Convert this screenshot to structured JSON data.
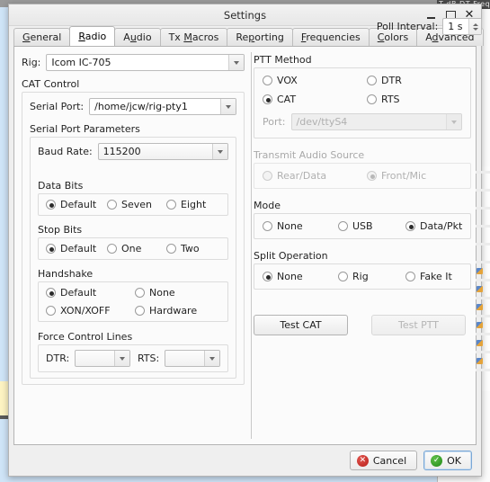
{
  "background": {
    "top_right_window_title": "T  dB   DT  Freq"
  },
  "window": {
    "title": "Settings",
    "controls": {
      "minimize": "minimize-icon",
      "maximize": "maximize-icon",
      "close": "close-icon"
    }
  },
  "tabs": [
    {
      "label": "General",
      "mnemonic": "G",
      "active": false
    },
    {
      "label": "Radio",
      "mnemonic": "R",
      "active": true
    },
    {
      "label": "Audio",
      "mnemonic": "u",
      "active": false
    },
    {
      "label": "Tx Macros",
      "mnemonic": "M",
      "active": false
    },
    {
      "label": "Reporting",
      "mnemonic": "p",
      "active": false
    },
    {
      "label": "Frequencies",
      "mnemonic": "F",
      "active": false
    },
    {
      "label": "Colors",
      "mnemonic": "C",
      "active": false
    },
    {
      "label": "Advanced",
      "mnemonic": "d",
      "active": false
    }
  ],
  "rig": {
    "label": "Rig:",
    "value": "Icom IC-705",
    "poll_interval_label": "Poll Interval:",
    "poll_interval_value": "1 s"
  },
  "cat_control": {
    "title": "CAT Control",
    "serial_port_label": "Serial Port:",
    "serial_port_value": "/home/jcw/rig-pty1",
    "serial_port_parameters_title": "Serial Port Parameters",
    "baud_rate_label": "Baud Rate:",
    "baud_rate_value": "115200",
    "data_bits": {
      "title": "Data Bits",
      "options": [
        {
          "label": "Default",
          "checked": true
        },
        {
          "label": "Seven",
          "checked": false
        },
        {
          "label": "Eight",
          "checked": false
        }
      ]
    },
    "stop_bits": {
      "title": "Stop Bits",
      "options": [
        {
          "label": "Default",
          "checked": true
        },
        {
          "label": "One",
          "checked": false
        },
        {
          "label": "Two",
          "checked": false
        }
      ]
    },
    "handshake": {
      "title": "Handshake",
      "options": [
        {
          "label": "Default",
          "checked": true
        },
        {
          "label": "None",
          "checked": false
        },
        {
          "label": "XON/XOFF",
          "checked": false
        },
        {
          "label": "Hardware",
          "checked": false
        }
      ]
    },
    "force_control_lines": {
      "title": "Force Control Lines",
      "dtr_label": "DTR:",
      "dtr_value": "",
      "rts_label": "RTS:",
      "rts_value": ""
    }
  },
  "ptt_method": {
    "title": "PTT Method",
    "options": [
      {
        "label": "VOX",
        "checked": false
      },
      {
        "label": "DTR",
        "checked": false
      },
      {
        "label": "CAT",
        "checked": true
      },
      {
        "label": "RTS",
        "checked": false
      }
    ],
    "port_label": "Port:",
    "port_value": "/dev/ttyS4",
    "port_disabled": true
  },
  "transmit_audio_source": {
    "title": "Transmit Audio Source",
    "disabled": true,
    "options": [
      {
        "label": "Rear/Data",
        "checked": false
      },
      {
        "label": "Front/Mic",
        "checked": true
      }
    ]
  },
  "mode": {
    "title": "Mode",
    "options": [
      {
        "label": "None",
        "checked": false
      },
      {
        "label": "USB",
        "checked": false
      },
      {
        "label": "Data/Pkt",
        "checked": true
      }
    ]
  },
  "split_operation": {
    "title": "Split Operation",
    "options": [
      {
        "label": "None",
        "checked": true
      },
      {
        "label": "Rig",
        "checked": false
      },
      {
        "label": "Fake It",
        "checked": false
      }
    ]
  },
  "test_buttons": {
    "test_cat_label": "Test CAT",
    "test_cat_disabled": false,
    "test_ptt_label": "Test PTT",
    "test_ptt_disabled": true
  },
  "footer": {
    "cancel_label": "Cancel",
    "ok_label": "OK",
    "cancel_icon_color": "#c02820",
    "ok_icon_color": "#2a9a20"
  }
}
